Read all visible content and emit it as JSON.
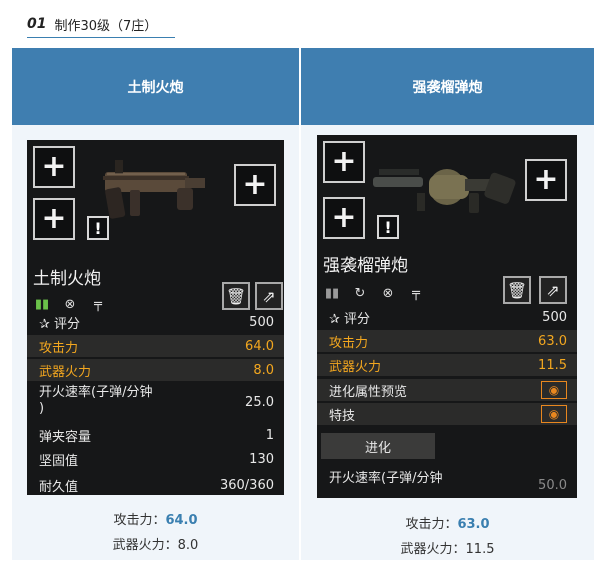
{
  "section": {
    "number": "01",
    "title": "制作30级（7庄）"
  },
  "columns": [
    {
      "header": "土制火炮",
      "card": {
        "name": "土制火炮",
        "rating_label": "评分",
        "rating_value": "500",
        "stats": [
          {
            "label": "攻击力",
            "value": "64.0",
            "highlight": true
          },
          {
            "label": "武器火力",
            "value": "8.0",
            "highlight": true
          },
          {
            "label": "开火速率(子弹/分钟)",
            "label_line1": "开火速率(子弹/分钟",
            "label_line2": ")",
            "value": "25.0"
          },
          {
            "label": "弹夹容量",
            "value": "1"
          },
          {
            "label": "坚固值",
            "value": "130"
          },
          {
            "label": "耐久值",
            "value": "360/360"
          }
        ]
      },
      "summary": {
        "attack_label": "攻击力：",
        "attack_value": "64.0",
        "firepower_label": "武器火力：",
        "firepower_value": "8.0"
      }
    },
    {
      "header": "强袭榴弹炮",
      "card": {
        "name": "强袭榴弹炮",
        "rating_label": "评分",
        "rating_value": "500",
        "stats": [
          {
            "label": "攻击力",
            "value": "63.0",
            "highlight": true
          },
          {
            "label": "武器火力",
            "value": "11.5",
            "highlight": true
          },
          {
            "label": "进化属性预览"
          },
          {
            "label": "特技"
          },
          {
            "label": "开火速率(子弹/分钟",
            "value": "50.0"
          }
        ],
        "evolve_label": "进化"
      },
      "summary": {
        "attack_label": "攻击力：",
        "attack_value": "63.0",
        "firepower_label": "武器火力：",
        "firepower_value": "11.5"
      }
    }
  ],
  "icons": [
    "plus-icon",
    "exclamation-icon",
    "ammo-icon",
    "crosshair-icon",
    "attachment-icon",
    "trash-icon",
    "share-icon",
    "rating-star-icon",
    "eye-icon",
    "refresh-icon"
  ],
  "colors": {
    "header_blue": "#3f7eb0",
    "accent_orange": "#f3a71f",
    "summary_blue": "#3a7fb0"
  }
}
